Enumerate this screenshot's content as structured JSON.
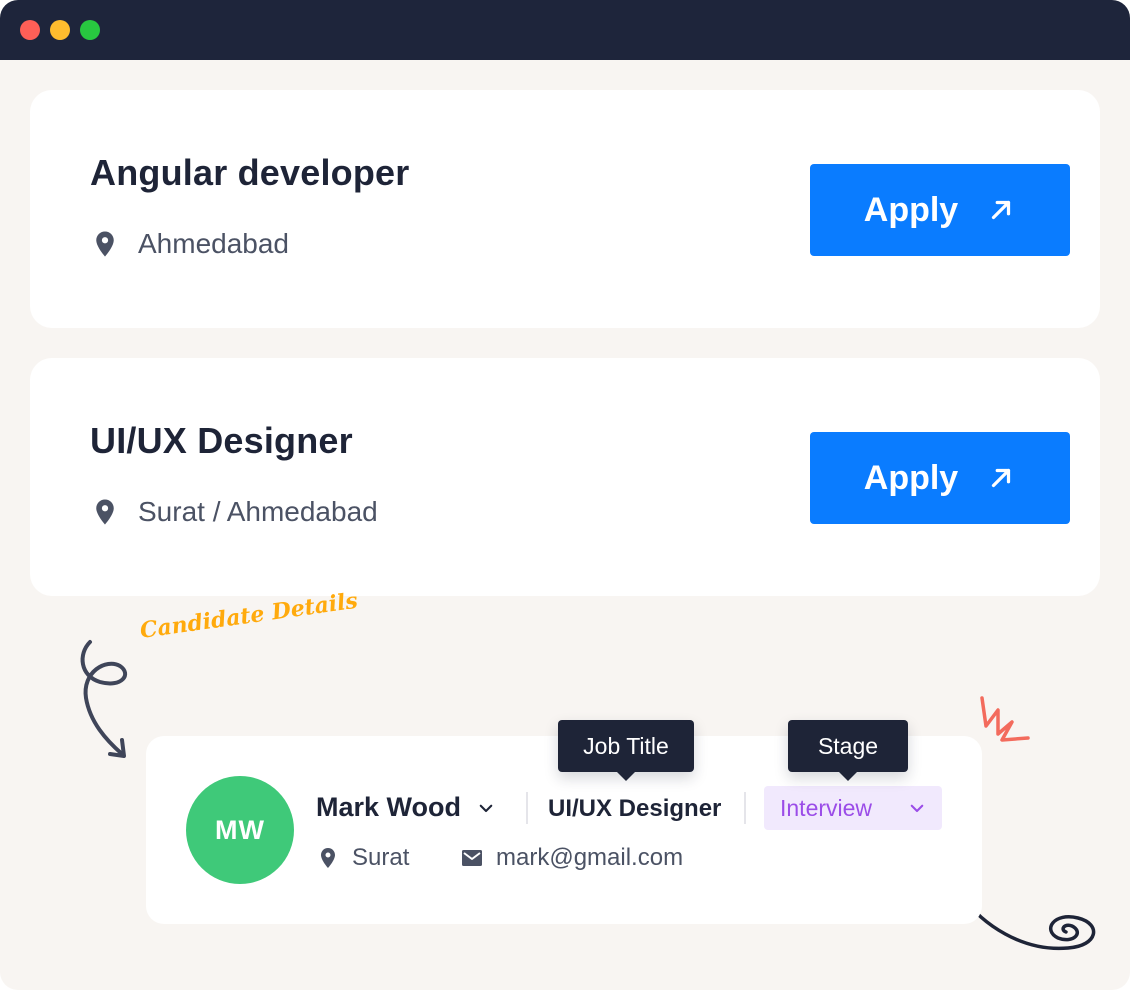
{
  "window": {
    "controls": [
      "close-dot",
      "minimize-dot",
      "maximize-dot"
    ]
  },
  "jobs": [
    {
      "title": "Angular developer",
      "location": "Ahmedabad",
      "apply_label": "Apply",
      "icon": "location-pin-icon"
    },
    {
      "title": "UI/UX Designer",
      "location": "Surat / Ahmedabad",
      "apply_label": "Apply",
      "icon": "location-pin-icon"
    }
  ],
  "annotation": {
    "text": "Candidate Details"
  },
  "candidate": {
    "initials": "MW",
    "name": "Mark Wood",
    "job_title": "UI/UX Designer",
    "stage": "Interview",
    "location": "Surat",
    "email": "mark@gmail.com",
    "avatar_color": "#3fc979"
  },
  "tooltips": {
    "job_title": "Job Title",
    "stage": "Stage"
  },
  "colors": {
    "accent": "#0a7cff",
    "annotation": "#ffaa0d",
    "stage_text": "#9b4de8",
    "stage_bg": "#f1e9fd",
    "titlebar": "#1e253b"
  }
}
